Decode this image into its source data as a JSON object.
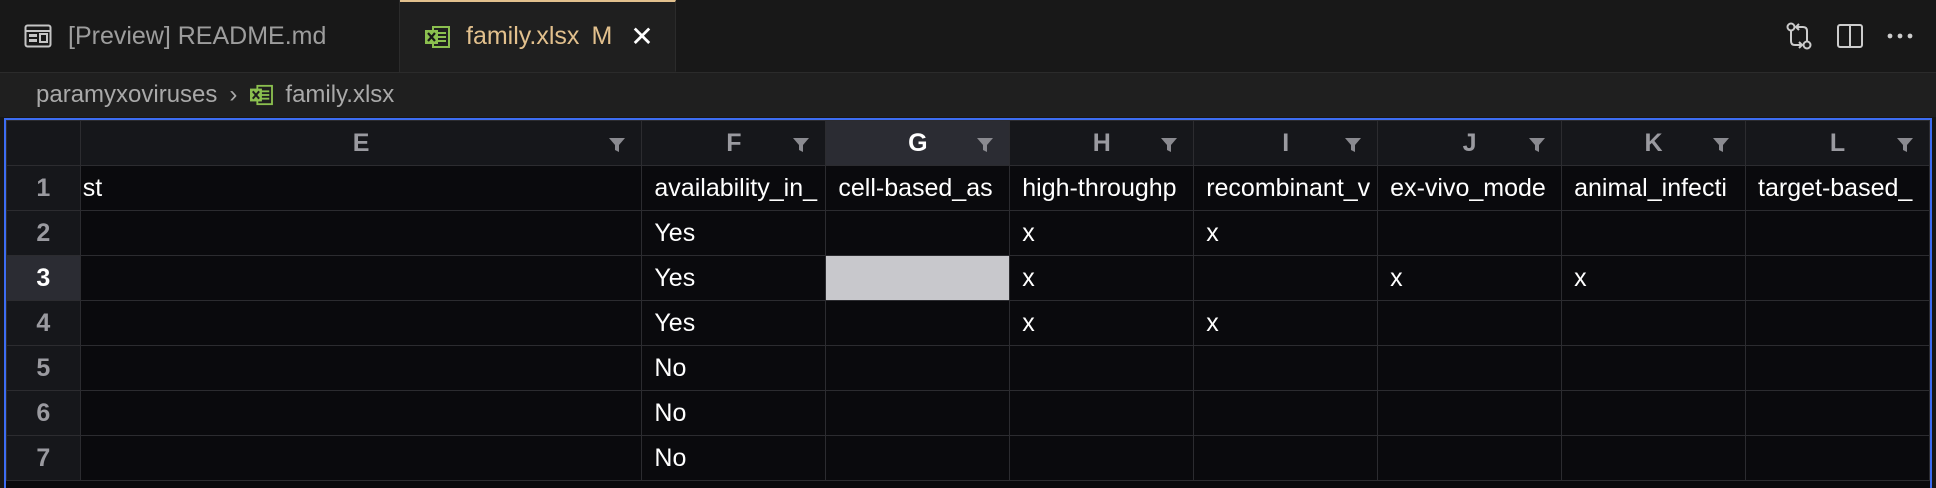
{
  "tabs": [
    {
      "label": "[Preview] README.md",
      "icon": "preview-icon"
    },
    {
      "label": "family.xlsx",
      "icon": "excel-file-icon",
      "modified_marker": "M",
      "close": "✕"
    }
  ],
  "tab_actions": [
    "compare-changes-icon",
    "split-editor-icon",
    "more-actions-icon"
  ],
  "breadcrumb": {
    "folder": "paramyxoviruses",
    "separator": "›",
    "file": "family.xlsx"
  },
  "sheet": {
    "columns": [
      "E",
      "F",
      "G",
      "H",
      "I",
      "J",
      "K",
      "L"
    ],
    "selected_column": "G",
    "selected_row": "3",
    "rows": [
      {
        "num": "1",
        "cells": [
          "st",
          "availability_in_",
          "cell-based_as",
          "high-throughp",
          "recombinant_v",
          "ex-vivo_mode",
          "animal_infecti",
          "target-based_"
        ]
      },
      {
        "num": "2",
        "cells": [
          "",
          "Yes",
          "",
          "x",
          "x",
          "",
          "",
          ""
        ]
      },
      {
        "num": "3",
        "cells": [
          "",
          "Yes",
          "",
          "x",
          "",
          "x",
          "x",
          ""
        ]
      },
      {
        "num": "4",
        "cells": [
          "",
          "Yes",
          "",
          "x",
          "x",
          "",
          "",
          ""
        ]
      },
      {
        "num": "5",
        "cells": [
          "",
          "No",
          "",
          "",
          "",
          "",
          "",
          ""
        ]
      },
      {
        "num": "6",
        "cells": [
          "",
          "No",
          "",
          "",
          "",
          "",
          "",
          ""
        ]
      },
      {
        "num": "7",
        "cells": [
          "",
          "No",
          "",
          "",
          "",
          "",
          "",
          ""
        ]
      }
    ]
  },
  "colors": {
    "accent": "#e2c08d",
    "selection_border": "#3d6df2",
    "excel_green": "#8bbf4f"
  }
}
